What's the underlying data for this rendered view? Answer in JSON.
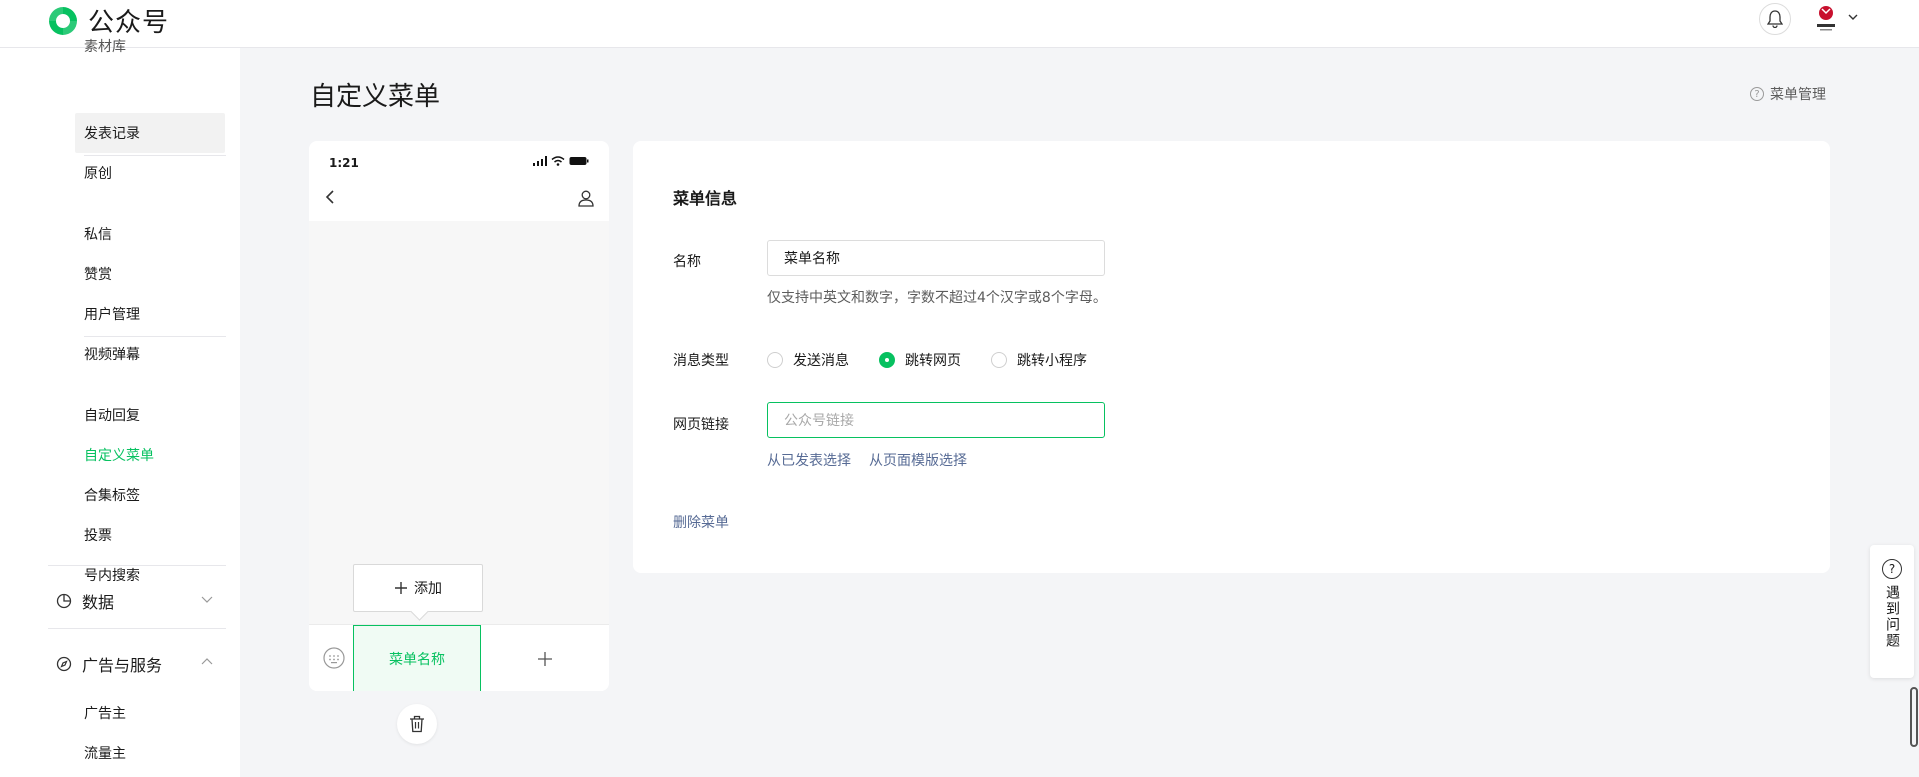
{
  "app": {
    "logo_text": "公众号"
  },
  "colors": {
    "accent": "#07c160",
    "link": "#576b95"
  },
  "sidebar": {
    "partial_top": "素材库",
    "items_group1": [
      "发表记录",
      "原创"
    ],
    "items_group2": [
      "私信",
      "赞赏",
      "用户管理",
      "视频弹幕"
    ],
    "items_group3": [
      "自动回复",
      "自定义菜单",
      "合集标签",
      "投票",
      "号内搜索"
    ],
    "group_data": "数据",
    "group_ads": "广告与服务",
    "items_ads": [
      "广告主",
      "流量主"
    ],
    "active_item": "自定义菜单"
  },
  "main": {
    "title": "自定义菜单",
    "help_link": "菜单管理"
  },
  "phone": {
    "time": "1:21",
    "add_label": "添加",
    "menu_item": "菜单名称"
  },
  "panel": {
    "title": "菜单信息",
    "name_label": "名称",
    "name_value": "菜单名称",
    "name_hint": "仅支持中英文和数字，字数不超过4个汉字或8个字母。",
    "type_label": "消息类型",
    "type_options": [
      "发送消息",
      "跳转网页",
      "跳转小程序"
    ],
    "type_selected": "跳转网页",
    "url_label": "网页链接",
    "url_placeholder": "公众号链接",
    "link_from_published": "从已发表选择",
    "link_from_template": "从页面模版选择",
    "delete_label": "删除菜单"
  },
  "help_widget": {
    "text": "遇到问题"
  }
}
